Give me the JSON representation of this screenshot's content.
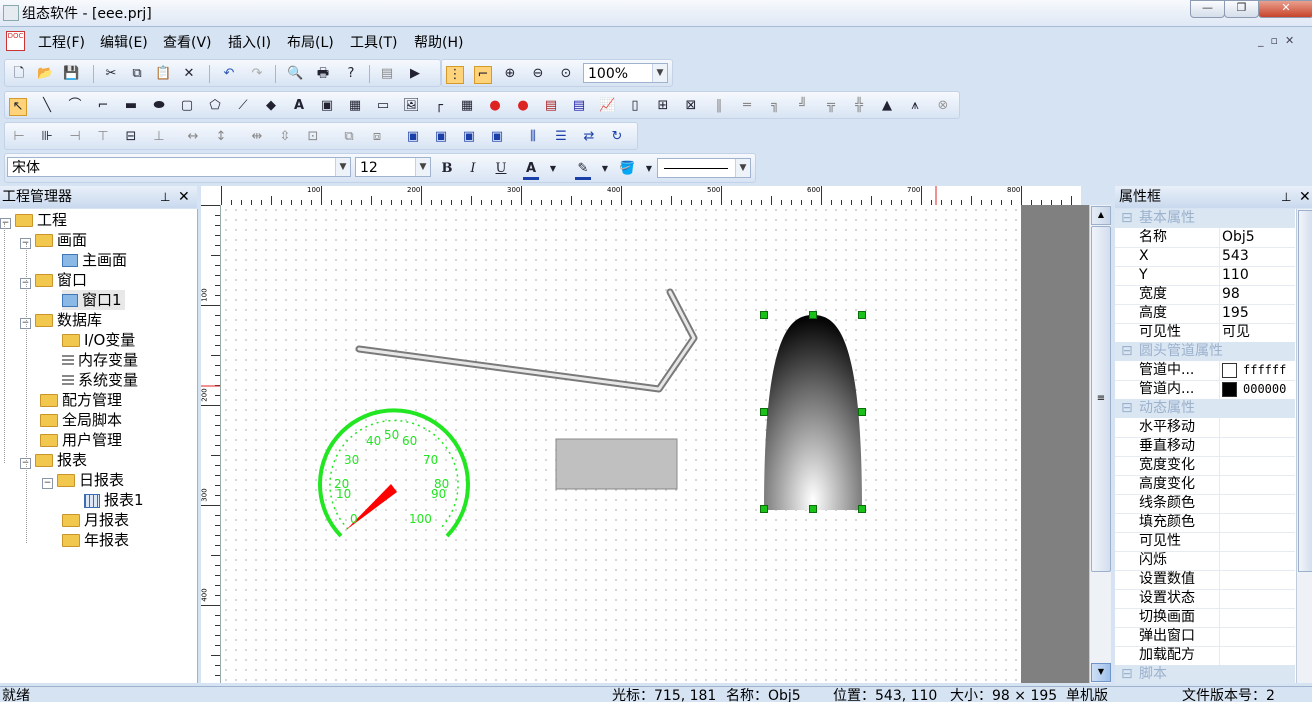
{
  "window": {
    "title": "组态软件 - [eee.prj]"
  },
  "menu": [
    "工程(F)",
    "编辑(E)",
    "查看(V)",
    "插入(I)",
    "布局(L)",
    "工具(T)",
    "帮助(H)"
  ],
  "toolbar": {
    "zoom": "100%"
  },
  "fontbar": {
    "font": "宋体",
    "size": "12"
  },
  "project_panel": {
    "title": "工程管理器",
    "tree": [
      "工程",
      "画面",
      "主画面",
      "窗口",
      "窗口1",
      "数据库",
      "I/O变量",
      "内存变量",
      "系统变量",
      "配方管理",
      "全局脚本",
      "用户管理",
      "报表",
      "日报表",
      "报表1",
      "月报表",
      "年报表"
    ]
  },
  "ruler": {
    "h": [
      "100",
      "200",
      "300",
      "400",
      "500",
      "600",
      "700",
      "800"
    ],
    "v": [
      "100",
      "200",
      "300",
      "400"
    ]
  },
  "gauge": {
    "labels": [
      "0",
      "10",
      "20",
      "30",
      "40",
      "50",
      "60",
      "70",
      "80",
      "90",
      "100"
    ]
  },
  "props_panel": {
    "title": "属性框",
    "groups": {
      "basic": "基本属性",
      "pipe": "圆头管道属性",
      "dynamic": "动态属性",
      "script": "脚本"
    },
    "basic": [
      {
        "k": "名称",
        "v": "Obj5"
      },
      {
        "k": "X",
        "v": "543"
      },
      {
        "k": "Y",
        "v": "110"
      },
      {
        "k": "宽度",
        "v": "98"
      },
      {
        "k": "高度",
        "v": "195"
      },
      {
        "k": "可见性",
        "v": "可见"
      }
    ],
    "pipe": [
      {
        "k": "管道中...",
        "v": "ffffff",
        "color": "#ffffff"
      },
      {
        "k": "管道内...",
        "v": "000000",
        "color": "#000000"
      }
    ],
    "dynamic": [
      "水平移动",
      "垂直移动",
      "宽度变化",
      "高度变化",
      "线条颜色",
      "填充颜色",
      "可见性",
      "闪烁",
      "设置数值",
      "设置状态",
      "切换画面",
      "弹出窗口",
      "加载配方"
    ]
  },
  "status": {
    "ready": "就绪",
    "cursor": "光标：715, 181",
    "name": "名称：Obj5",
    "position": "位置：543, 110",
    "size": "大小：98 × 195",
    "mode": "单机版",
    "version": "文件版本号：2"
  },
  "colors": {
    "accent": "#d6e3f3",
    "gauge": "#22e622",
    "needle": "#ff0000"
  }
}
